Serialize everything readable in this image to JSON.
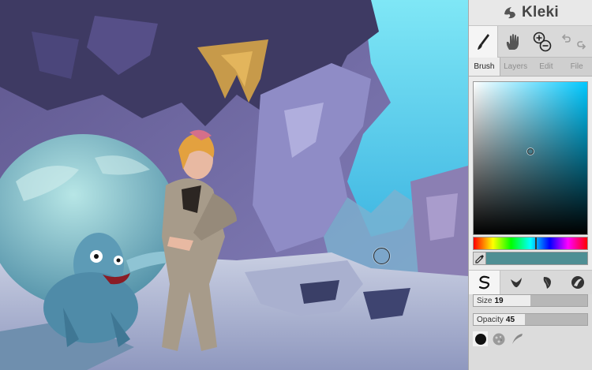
{
  "app": {
    "name": "Kleki"
  },
  "toolbar": {
    "tools": [
      {
        "name": "brush",
        "icon": "brush-icon",
        "active": true
      },
      {
        "name": "hand",
        "icon": "hand-icon",
        "active": false
      },
      {
        "name": "zoom",
        "icon": "zoom-icon",
        "active": false
      },
      {
        "name": "history",
        "icon": "undo-redo-icon",
        "active": false
      }
    ]
  },
  "tabs": [
    {
      "label": "Brush",
      "active": true
    },
    {
      "label": "Layers",
      "active": false
    },
    {
      "label": "Edit",
      "active": false
    },
    {
      "label": "File",
      "active": false
    }
  ],
  "color": {
    "current": "#4f8f94",
    "hue_base": "#00c8ff",
    "hue_position": 0.54,
    "saturation": 0.47,
    "value": 0.56
  },
  "brush_types": [
    {
      "icon": "pen-brush-icon",
      "active": true
    },
    {
      "icon": "blend-brush-icon",
      "active": false
    },
    {
      "icon": "sketchy-brush-icon",
      "active": false
    },
    {
      "icon": "pixel-brush-icon",
      "active": false
    }
  ],
  "brush_settings": {
    "size_label": "Size",
    "size_value": "19",
    "size_fraction": 0.5,
    "opacity_label": "Opacity",
    "opacity_value": "45",
    "opacity_fraction": 0.45
  },
  "brush_shapes": [
    {
      "icon": "circle-shape-icon",
      "active": true
    },
    {
      "icon": "chalk-shape-icon",
      "active": false
    },
    {
      "icon": "calligraphy-shape-icon",
      "active": false
    }
  ],
  "canvas": {
    "painting_colors": {
      "sky": "#6ad6ee",
      "rock": "#7f79b2",
      "rock_dark": "#3e3a63",
      "floor": "#b8c0d8",
      "creature": "#5d9bb6",
      "figure": "#a79b8a",
      "hair": "#e3a13f"
    }
  }
}
